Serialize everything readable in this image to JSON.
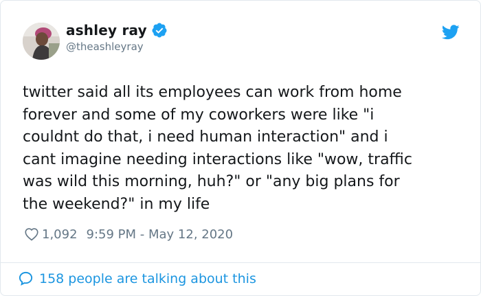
{
  "tweet": {
    "author": {
      "display_name": "ashley ray",
      "handle": "@theashleyray",
      "verified": true
    },
    "text": "twitter said all its employees can work from home\nforever and some of my coworkers were like \"i\ncouldnt do that, i need human interaction\" and i\ncant imagine needing interactions like \"wow, traffic\nwas wild this morning, huh?\" or \"any big plans for\nthe weekend?\" in my life",
    "likes": "1,092",
    "timestamp": "9:59 PM - May 12, 2020",
    "talking_about": "158 people are talking about this"
  },
  "colors": {
    "brand": "#1da1f2",
    "link": "#1b95e0",
    "muted": "#657786",
    "text": "#14171a",
    "border": "#e1e8ed"
  },
  "icons": {
    "verified": "verified-badge-icon",
    "logo": "twitter-bird-icon",
    "like": "heart-outline-icon",
    "replies": "speech-bubble-icon"
  }
}
